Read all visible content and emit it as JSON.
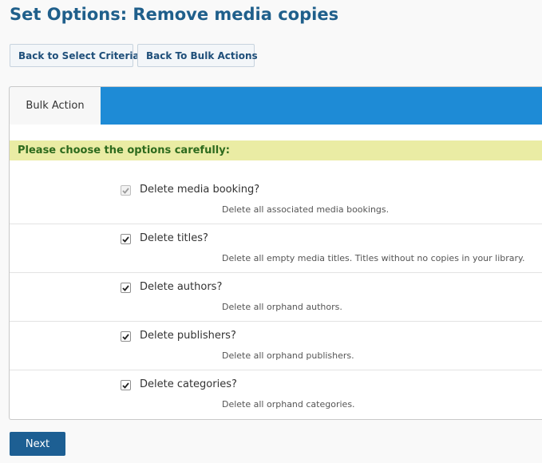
{
  "page": {
    "title": "Set Options: Remove media copies"
  },
  "nav": {
    "back_criteria": "Back to Select Criteria",
    "back_bulk": "Back To Bulk Actions"
  },
  "tabs": [
    {
      "label": "Bulk Action",
      "active": true
    }
  ],
  "notice": "Please choose the options carefully:",
  "options": [
    {
      "label": "Delete media booking?",
      "description": "Delete all associated media bookings.",
      "checked": true,
      "disabled": true
    },
    {
      "label": "Delete titles?",
      "description": "Delete all empty media titles. Titles without no copies in your library.",
      "checked": true,
      "disabled": false
    },
    {
      "label": "Delete authors?",
      "description": "Delete all orphand authors.",
      "checked": true,
      "disabled": false
    },
    {
      "label": "Delete publishers?",
      "description": "Delete all orphand publishers.",
      "checked": true,
      "disabled": false
    },
    {
      "label": "Delete categories?",
      "description": "Delete all orphand categories.",
      "checked": true,
      "disabled": false
    }
  ],
  "next_label": "Next",
  "colors": {
    "title": "#1f5f8b",
    "tab_bar": "#1e8bd6",
    "notice_bg": "#eaeca4",
    "notice_text": "#2d6a1d",
    "next_bg": "#1d5f93"
  }
}
